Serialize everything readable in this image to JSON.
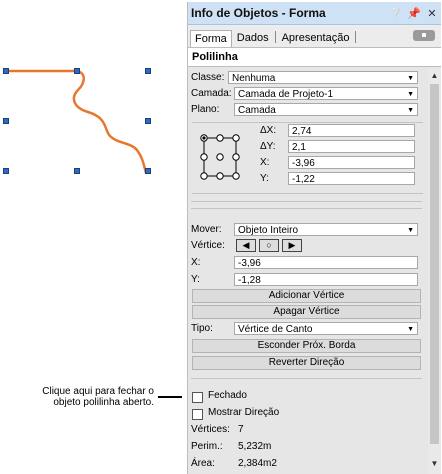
{
  "callout": {
    "text": "Clique aqui para fechar o objeto polilinha aberto."
  },
  "panel": {
    "title": "Info de Objetos - Forma",
    "title_icons": [
      "lightbulb-icon",
      "pin-icon",
      "close-icon"
    ],
    "tabs": [
      {
        "label": "Forma",
        "active": true
      },
      {
        "label": "Dados",
        "active": false
      },
      {
        "label": "Apresentação",
        "active": false
      }
    ],
    "object_type": "Polilinha",
    "classe": {
      "label": "Classe:",
      "value": "Nenhuma"
    },
    "camada": {
      "label": "Camada:",
      "value": "Camada de Projeto-1"
    },
    "plano": {
      "label": "Plano:",
      "value": "Camada"
    },
    "delta_x": {
      "label": "ΔX:",
      "value": "2,74"
    },
    "delta_y": {
      "label": "ΔY:",
      "value": "2,1"
    },
    "x_pos": {
      "label": "X:",
      "value": "-3,96"
    },
    "y_pos": {
      "label": "Y:",
      "value": "-1,22"
    },
    "mover": {
      "label": "Mover:",
      "value": "Objeto Inteiro"
    },
    "vertice": {
      "label": "Vértice:"
    },
    "vertex_x": {
      "label": "X:",
      "value": "-3,96"
    },
    "vertex_y": {
      "label": "Y:",
      "value": "-1,28"
    },
    "buttons": {
      "add_vertex": "Adicionar Vértice",
      "delete_vertex": "Apagar Vértice",
      "hide_edge": "Esconder Próx. Borda",
      "reverse": "Reverter Direção"
    },
    "tipo": {
      "label": "Tipo:",
      "value": "Vértice de Canto"
    },
    "fechado": {
      "label": "Fechado",
      "checked": false
    },
    "mostrar_direcao": {
      "label": "Mostrar Direção",
      "checked": false
    },
    "vertices": {
      "label": "Vértices:",
      "value": "7"
    },
    "perim": {
      "label": "Perim.:",
      "value": "5,232m"
    },
    "area": {
      "label": "Área:",
      "value": "2,384m2"
    }
  },
  "colors": {
    "curve": "#e8772e",
    "handle": "#2d6ac0",
    "titlebar": "#cfe1f5",
    "panel_bg": "#e6e6e6"
  }
}
